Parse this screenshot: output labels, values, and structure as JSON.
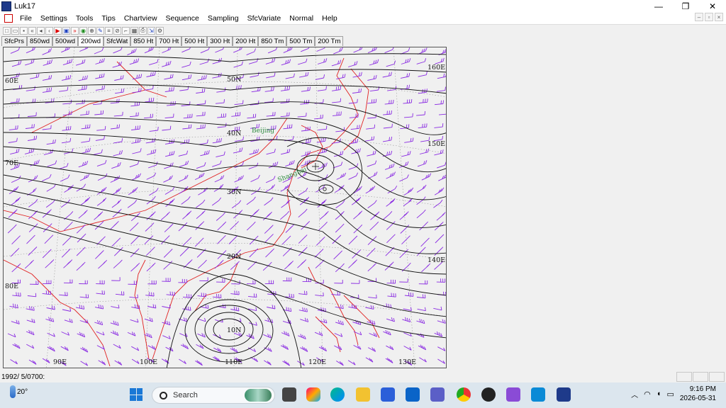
{
  "window": {
    "title": "Luk17",
    "minimize": "—",
    "maximize": "❐",
    "close": "✕"
  },
  "menu": [
    "File",
    "Settings",
    "Tools",
    "Tips",
    "Chartview",
    "Sequence",
    "Sampling",
    "SfcVariate",
    "Normal",
    "Help"
  ],
  "mdi": {
    "minimize": "‒",
    "restore": "▫",
    "close": "×"
  },
  "toolbar": [
    "new-icon",
    "open-icon",
    "save-icon",
    "first-icon",
    "prev-icon",
    "prev-step-icon",
    "stop-icon",
    "play-icon",
    "frame-icon",
    "fast-forward-icon",
    "globe-icon",
    "zoom-icon",
    "pen-icon",
    "text-icon",
    "lasso-icon",
    "line-icon",
    "grid-icon",
    "print-icon",
    "export-icon"
  ],
  "tabs": [
    "SfcPrs",
    "850wd",
    "500wd",
    "200wd",
    "SfcWat",
    "850 Ht",
    "700 Ht",
    "500 Ht",
    "300 Ht",
    "200 Ht",
    "850 Tm",
    "500 Tm",
    "200 Tm"
  ],
  "active_tab": "200wd",
  "map": {
    "lat_labels": [
      "50N",
      "40N",
      "30N",
      "20N",
      "10N"
    ],
    "lon_labels_bottom": [
      "90E",
      "100E",
      "110E",
      "120E",
      "130E"
    ],
    "lon_labels_left": [
      "60E",
      "70E",
      "80E"
    ],
    "lon_labels_right": [
      "160E",
      "150E",
      "140E"
    ],
    "cities": [
      "Beijing",
      "Shanghai"
    ],
    "colors": {
      "contour": "#111111",
      "wind": "#8a2be2",
      "coast": "#e02020",
      "city": "#2e8b3e",
      "grid": "#999999"
    }
  },
  "status": {
    "text": "1992/ 5/0700:"
  },
  "taskbar": {
    "weather": "20°",
    "search_placeholder": "Search",
    "apps": [
      "start-icon",
      "file-explorer-icon",
      "copilot-icon",
      "edge-icon",
      "folder-icon",
      "store-icon",
      "outlook-icon",
      "teams-icon",
      "chrome-icon",
      "media-icon",
      "visual-studio-icon",
      "remote-icon",
      "luk17-icon"
    ],
    "time": "9:16 PM",
    "date": "2026-05-31"
  }
}
